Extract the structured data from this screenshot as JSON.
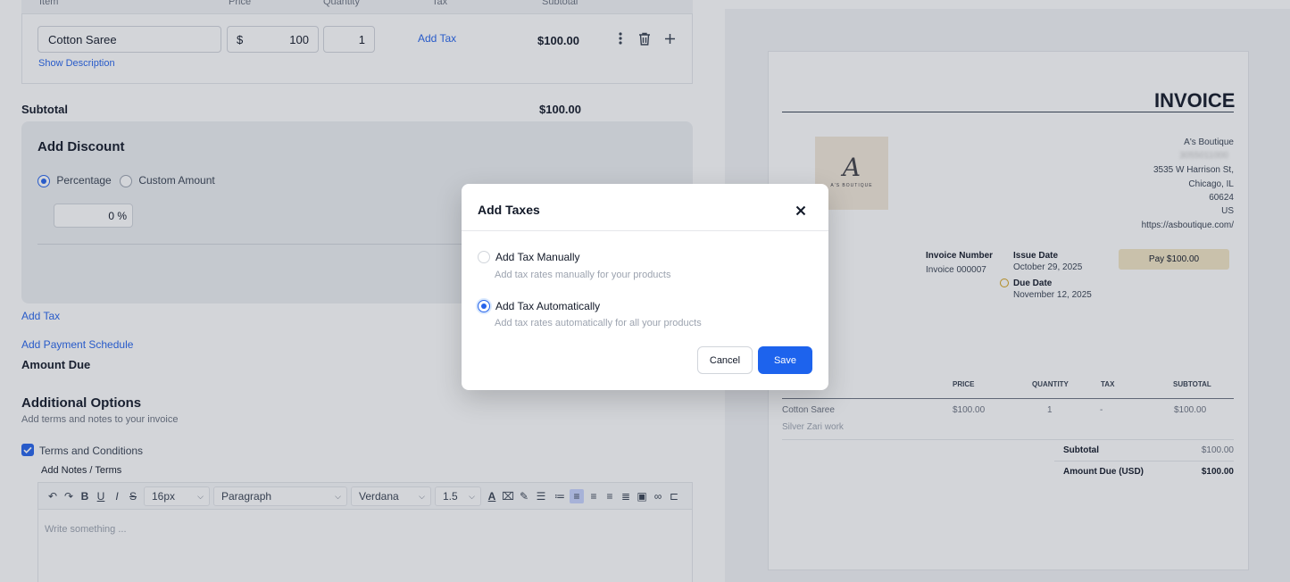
{
  "items": {
    "headers": [
      "Item",
      "Price",
      "Quantity",
      "Tax",
      "Subtotal"
    ],
    "row": {
      "name": "Cotton Saree",
      "currency": "$",
      "price": "100",
      "quantity": "1",
      "add_tax": "Add Tax",
      "subtotal": "$100.00"
    },
    "show_description": "Show Description"
  },
  "subtotal": {
    "label": "Subtotal",
    "value": "$100.00"
  },
  "discount": {
    "title": "Add Discount",
    "opt_percentage": "Percentage",
    "opt_custom": "Custom Amount",
    "value": "0 %"
  },
  "links": {
    "add_tax": "Add Tax",
    "add_payment_schedule": "Add Payment Schedule"
  },
  "amount_due_label": "Amount Due",
  "additional": {
    "title": "Additional Options",
    "subtitle": "Add terms and notes to your invoice",
    "terms_label": "Terms and Conditions",
    "notes_label": "Add Notes / Terms"
  },
  "toolbar": {
    "font_size": "16px",
    "block": "Paragraph",
    "font": "Verdana",
    "line_height": "1.5",
    "placeholder": "Write something ..."
  },
  "preview": {
    "title": "INVOICE",
    "logo_letter": "A",
    "logo_text": "A'S BOUTIQUE",
    "company": "A's Boutique",
    "phone_blurred": "3055011000",
    "address1": "3535 W Harrison St,",
    "address2": "Chicago, IL",
    "zip": "60624",
    "country": "US",
    "website": "https://asboutique.com/",
    "invoice_number_label": "Invoice Number",
    "invoice_number": "Invoice 000007",
    "issue_date_label": "Issue Date",
    "issue_date": "October 29, 2025",
    "due_date_label": "Due Date",
    "due_date": "November 12, 2025",
    "pay_button": "Pay $100.00",
    "table_headers": [
      "PRICE",
      "QUANTITY",
      "TAX",
      "SUBTOTAL"
    ],
    "row": {
      "item": "Cotton Saree",
      "description": "Silver Zari work",
      "price": "$100.00",
      "quantity": "1",
      "tax": "-",
      "subtotal": "$100.00"
    },
    "subtotal_label": "Subtotal",
    "subtotal_value": "$100.00",
    "amount_due_label": "Amount Due (USD)",
    "amount_due_value": "$100.00"
  },
  "modal": {
    "title": "Add Taxes",
    "option_manual": "Add Tax Manually",
    "option_manual_desc": "Add tax rates manually for your products",
    "option_auto": "Add Tax Automatically",
    "option_auto_desc": "Add tax rates automatically for all your products",
    "selected": "auto",
    "cancel": "Cancel",
    "save": "Save"
  },
  "colors": {
    "accent": "#1d63ed",
    "link": "#2563eb",
    "pay_button": "#f3e6c4",
    "logo_bg": "#f3e8d9"
  }
}
